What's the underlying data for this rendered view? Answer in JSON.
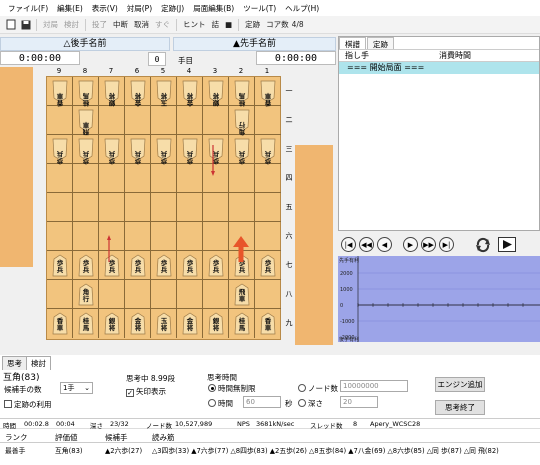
{
  "menu": {
    "items": [
      "ファイル(F)",
      "編集(E)",
      "表示(V)",
      "対局(P)",
      "定跡(J)",
      "局面編集(B)",
      "ツール(T)",
      "ヘルプ(H)"
    ]
  },
  "toolbar": {
    "buttons": [
      {
        "label": "対局",
        "disabled": true
      },
      {
        "label": "検討",
        "disabled": true
      },
      {
        "sep": true
      },
      {
        "label": "投了",
        "disabled": true
      },
      {
        "label": "中断",
        "disabled": false
      },
      {
        "label": "取消",
        "disabled": false
      },
      {
        "label": "すぐ",
        "disabled": true
      },
      {
        "sep": true
      },
      {
        "label": "ヒント",
        "disabled": false
      },
      {
        "label": "詰",
        "disabled": false
      },
      {
        "label": "■",
        "disabled": false
      },
      {
        "sep": true
      },
      {
        "label": "定跡",
        "disabled": false
      },
      {
        "label": "コア数",
        "disabled": false
      },
      {
        "label": "4/8",
        "disabled": false
      }
    ]
  },
  "players": {
    "gote_name": "△後手名前",
    "sente_name": "▲先手名前",
    "gote_time": "0:00:00",
    "sente_time": "0:00:00",
    "move_no": "0",
    "move_unit": "手目"
  },
  "board": {
    "files": [
      "9",
      "8",
      "7",
      "6",
      "5",
      "4",
      "3",
      "2",
      "1"
    ],
    "ranks": [
      "一",
      "二",
      "三",
      "四",
      "五",
      "六",
      "七",
      "八",
      "九"
    ],
    "rows": [
      [
        "香車",
        "桂馬",
        "銀将",
        "金将",
        "玉将",
        "金将",
        "銀将",
        "桂馬",
        "香車"
      ],
      [
        "",
        "飛車",
        "",
        "",
        "",
        "",
        "",
        "角行",
        ""
      ],
      [
        "歩兵",
        "歩兵",
        "歩兵",
        "歩兵",
        "歩兵",
        "歩兵",
        "歩兵",
        "歩兵",
        "歩兵"
      ],
      [
        "",
        "",
        "",
        "",
        "",
        "",
        "",
        "",
        ""
      ],
      [
        "",
        "",
        "",
        "",
        "",
        "",
        "",
        "",
        ""
      ],
      [
        "",
        "",
        "",
        "",
        "",
        "",
        "",
        "",
        ""
      ],
      [
        "歩兵",
        "歩兵",
        "歩兵",
        "歩兵",
        "歩兵",
        "歩兵",
        "歩兵",
        "歩兵",
        "歩兵"
      ],
      [
        "",
        "角行",
        "",
        "",
        "",
        "",
        "",
        "飛車",
        ""
      ],
      [
        "香車",
        "桂馬",
        "銀将",
        "金将",
        "玉将",
        "金将",
        "銀将",
        "桂馬",
        "香車"
      ]
    ],
    "gote_rows": [
      0,
      1,
      2
    ]
  },
  "kifu": {
    "tabs": [
      "棋譜",
      "定跡"
    ],
    "col_move": "指し手",
    "col_time": "消費時間",
    "rows": [
      "=== 開始局面 ==="
    ]
  },
  "graph": {
    "labels": [
      "先手有利",
      "2000",
      "1000",
      "0",
      "-1000",
      "-2000",
      "後手有利"
    ]
  },
  "bottom": {
    "tabs": [
      "思考",
      "検討"
    ],
    "title": "互角(83)",
    "candidates_label": "候補手の数",
    "candidates_value": "1手",
    "book_label": "定跡の利用",
    "thinking": "思考中 8.99段",
    "arrow_label": "矢印表示",
    "time_label": "思考時間",
    "opt_unlimited": "時間無制限",
    "opt_time": "時間",
    "time_value": "60",
    "sec": "秒",
    "opt_nodes": "ノード数",
    "nodes_value": "10000000",
    "opt_depth": "深さ",
    "depth_value": "20",
    "engine_add": "エンジン追加",
    "stop_think": "思考終了",
    "stats": [
      "時間",
      "00:02.8",
      "00:04",
      "深さ",
      "23/32",
      "ノード数",
      "10,527,989",
      "NPS",
      "3681kN/sec",
      "スレッド数",
      "8",
      "Apery_WCSC28"
    ],
    "headers": [
      "ランク",
      "評価値",
      "候補手",
      "読み筋"
    ],
    "best_rank": "最善手",
    "best_eval": "互角(83)",
    "best_move": "▲2六歩(27)",
    "pv": "△3四歩(33) ▲7六歩(77) △8四歩(83) ▲2五歩(26) △8五歩(84) ▲7八金(69) △8六歩(85) △同 歩(87) △同 飛(82)"
  }
}
